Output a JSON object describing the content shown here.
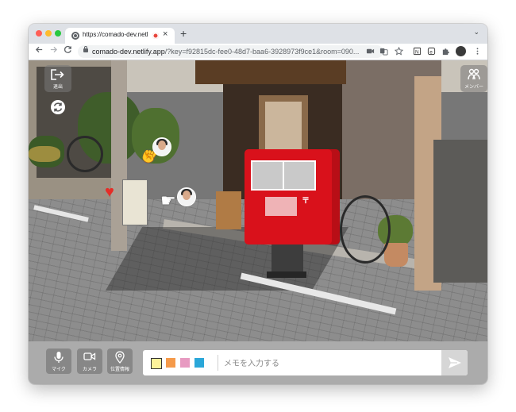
{
  "browser": {
    "tab_title": "https://comado-dev.netlify.app",
    "tab_close": "×",
    "new_tab": "+",
    "tab_menu": "⌄",
    "url_host": "comado-dev.netlify.app",
    "url_path": "/?key=f92815dc-fee0-48d7-baa6-3928973f9ce1&room=090..."
  },
  "overlay": {
    "exit_label": "退出",
    "members_label": "メンバー"
  },
  "bottom": {
    "mic_label": "マイク",
    "camera_label": "カメラ",
    "location_label": "位置情報",
    "memo_placeholder": "メモを入力する",
    "colors": [
      "#fdf29a",
      "#f59a4a",
      "#e79ac1",
      "#2aa7d9"
    ]
  },
  "scene": {
    "mailbox_mark": "〒"
  }
}
